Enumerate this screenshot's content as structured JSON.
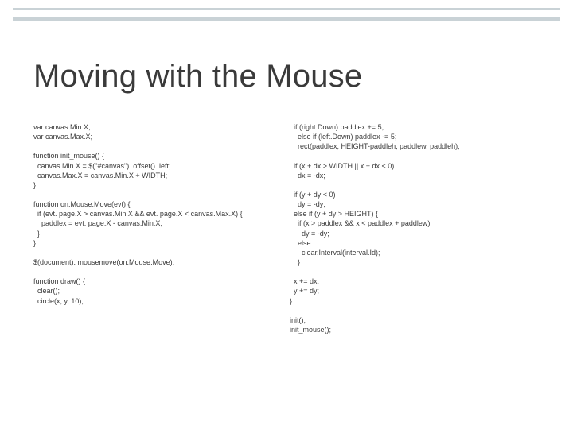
{
  "slide": {
    "title": "Moving with the Mouse",
    "code_left": "var canvas.Min.X;\nvar canvas.Max.X;\n\nfunction init_mouse() {\n  canvas.Min.X = $(\"#canvas\"). offset(). left;\n  canvas.Max.X = canvas.Min.X + WIDTH;\n}\n\nfunction on.Mouse.Move(evt) {\n  if (evt. page.X > canvas.Min.X && evt. page.X < canvas.Max.X) {\n    paddlex = evt. page.X - canvas.Min.X;\n  }\n}\n\n$(document). mousemove(on.Mouse.Move);\n\nfunction draw() {\n  clear();\n  circle(x, y, 10);",
    "code_right": "  if (right.Down) paddlex += 5;\n    else if (left.Down) paddlex -= 5;\n    rect(paddlex, HEIGHT-paddleh, paddlew, paddleh);\n\n  if (x + dx > WIDTH || x + dx < 0)\n    dx = -dx;\n\n  if (y + dy < 0)\n    dy = -dy;\n  else if (y + dy > HEIGHT) {\n    if (x > paddlex && x < paddlex + paddlew)\n      dy = -dy;\n    else\n      clear.Interval(interval.Id);\n    }\n\n  x += dx;\n  y += dy;\n}\n\ninit();\ninit_mouse();"
  }
}
